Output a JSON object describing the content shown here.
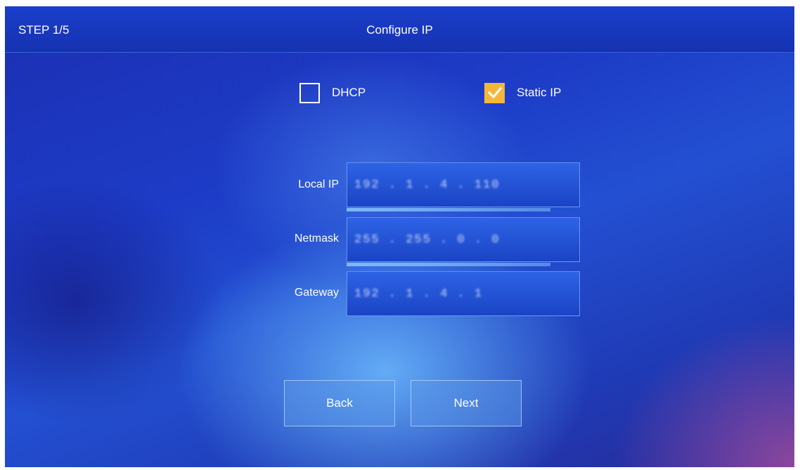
{
  "header": {
    "step": "STEP 1/5",
    "title": "Configure IP"
  },
  "ip_mode": {
    "options": [
      {
        "label": "DHCP",
        "checked": false
      },
      {
        "label": "Static IP",
        "checked": true
      }
    ]
  },
  "fields": [
    {
      "label": "Local IP",
      "value": "192 . 1 . 4 . 110"
    },
    {
      "label": "Netmask",
      "value": "255 . 255 . 0 . 0"
    },
    {
      "label": "Gateway",
      "value": "192 . 1 . 4 . 1"
    }
  ],
  "buttons": {
    "back_label": "Back",
    "next_label": "Next"
  },
  "colors": {
    "checkbox_checked": "#f5b73a",
    "header_bg": "#1b3fcb",
    "field_bg": "#2e63e6"
  },
  "icons": {
    "checked_mark": "checkmark-icon"
  }
}
